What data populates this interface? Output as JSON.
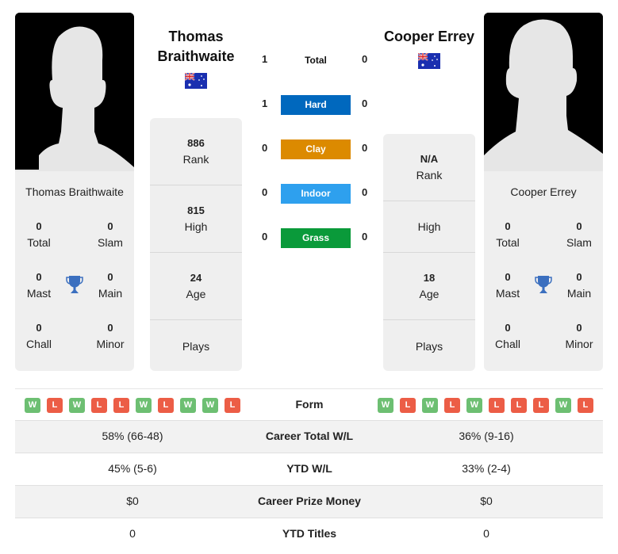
{
  "players": {
    "left": {
      "name": "Thomas Braithwaite",
      "title_line1": "Thomas",
      "title_line2": "Braithwaite",
      "country_flag": "australia-flag",
      "titles": {
        "total": {
          "value": "0",
          "label": "Total"
        },
        "slam": {
          "value": "0",
          "label": "Slam"
        },
        "mast": {
          "value": "0",
          "label": "Mast"
        },
        "main": {
          "value": "0",
          "label": "Main"
        },
        "chall": {
          "value": "0",
          "label": "Chall"
        },
        "minor": {
          "value": "0",
          "label": "Minor"
        }
      },
      "info": {
        "rank": {
          "value": "886",
          "label": "Rank"
        },
        "high": {
          "value": "815",
          "label": "High"
        },
        "age": {
          "value": "24",
          "label": "Age"
        },
        "plays": {
          "value": "",
          "label": "Plays"
        }
      },
      "form": [
        "W",
        "L",
        "W",
        "L",
        "L",
        "W",
        "L",
        "W",
        "W",
        "L"
      ]
    },
    "right": {
      "name": "Cooper Errey",
      "title_line1": "Cooper Errey",
      "country_flag": "australia-flag",
      "titles": {
        "total": {
          "value": "0",
          "label": "Total"
        },
        "slam": {
          "value": "0",
          "label": "Slam"
        },
        "mast": {
          "value": "0",
          "label": "Mast"
        },
        "main": {
          "value": "0",
          "label": "Main"
        },
        "chall": {
          "value": "0",
          "label": "Chall"
        },
        "minor": {
          "value": "0",
          "label": "Minor"
        }
      },
      "info": {
        "rank": {
          "value": "N/A",
          "label": "Rank"
        },
        "high": {
          "value": "",
          "label": "High"
        },
        "age": {
          "value": "18",
          "label": "Age"
        },
        "plays": {
          "value": "",
          "label": "Plays"
        }
      },
      "form": [
        "W",
        "L",
        "W",
        "L",
        "W",
        "L",
        "L",
        "L",
        "W",
        "L"
      ]
    }
  },
  "h2h": [
    {
      "surface": "Total",
      "left": "1",
      "right": "0",
      "color": ""
    },
    {
      "surface": "Hard",
      "left": "1",
      "right": "0",
      "color": "#0068be"
    },
    {
      "surface": "Clay",
      "left": "0",
      "right": "0",
      "color": "#dc8a00"
    },
    {
      "surface": "Indoor",
      "left": "0",
      "right": "0",
      "color": "#2ea0ee"
    },
    {
      "surface": "Grass",
      "left": "0",
      "right": "0",
      "color": "#0a9a3a"
    }
  ],
  "comparison": {
    "form_label": "Form",
    "rows": [
      {
        "label": "Career Total W/L",
        "left": "58% (66-48)",
        "right": "36% (9-16)"
      },
      {
        "label": "YTD W/L",
        "left": "45% (5-6)",
        "right": "33% (2-4)"
      },
      {
        "label": "Career Prize Money",
        "left": "$0",
        "right": "$0"
      },
      {
        "label": "YTD Titles",
        "left": "0",
        "right": "0"
      }
    ]
  },
  "colors": {
    "win": "#6dbf72",
    "loss": "#ec5d46",
    "trophy": "#3b6fbf"
  }
}
